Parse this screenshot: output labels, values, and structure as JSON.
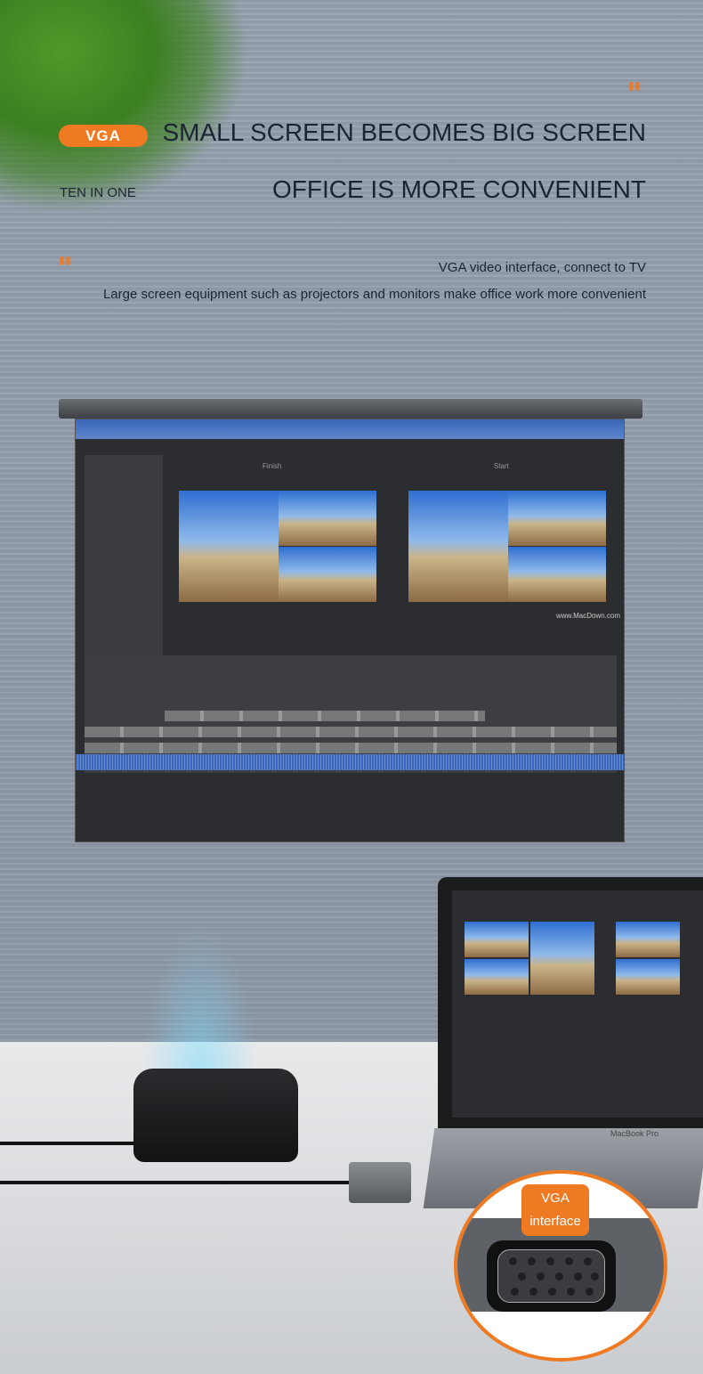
{
  "badge": "VGA",
  "headline_1": "SMALL SCREEN BECOMES BIG SCREEN",
  "headline_2": "OFFICE IS MORE CONVENIENT",
  "tagline": "TEN IN ONE",
  "subtitle_1": "VGA video interface, connect to TV",
  "subtitle_2": "Large screen equipment such as projectors and monitors make office work more convenient",
  "screen": {
    "finish": "Finish",
    "start": "Start",
    "site": "www.MacDown.com"
  },
  "laptop_label": "MacBook Pro",
  "callout": {
    "line1": "VGA",
    "line2": "interface"
  },
  "colors": {
    "accent": "#ef7a22",
    "text": "#1c2433"
  }
}
